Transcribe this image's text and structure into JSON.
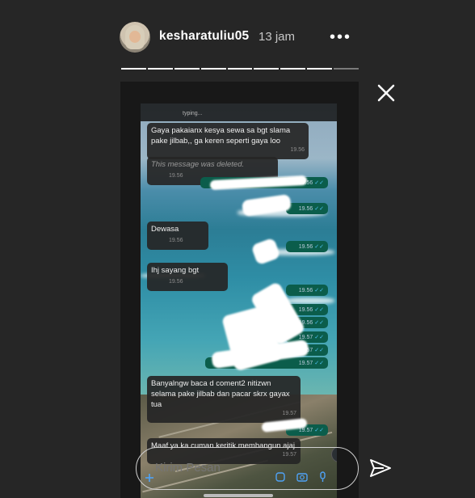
{
  "story": {
    "username": "kesharatuliu05",
    "time_ago": "13 jam",
    "more_label": "•••",
    "segments_total": 9,
    "segments_seen": 8
  },
  "chat": {
    "typing": "typing...",
    "messages": [
      {
        "text": "Gaya pakaianx kesya sewa sa bgt slama pake jilbab,, ga keren seperti gaya loo",
        "time": "19.56"
      },
      {
        "text": "This message was deleted.",
        "time": "19.56"
      },
      {
        "text": "Dewasa",
        "time": "19.56"
      },
      {
        "text": "Ihj sayang bgt",
        "time": "19.56"
      },
      {
        "text": "Banyalngw baca d coment2 nitizwn selama pake jilbab dan pacar skrx gayax tua",
        "time": "19.57"
      },
      {
        "text": "Maaf ya ka cuman keritik membangun ajaj",
        "time": "19.57"
      }
    ],
    "sent_times": [
      "19.56",
      "19.56",
      "19.56",
      "19.56",
      "19.56",
      "19.56",
      "19.57",
      "19.57",
      "19.57",
      "19.57"
    ],
    "scroll_label": "⌄"
  },
  "reply": {
    "placeholder": "Kirim Pesan"
  }
}
